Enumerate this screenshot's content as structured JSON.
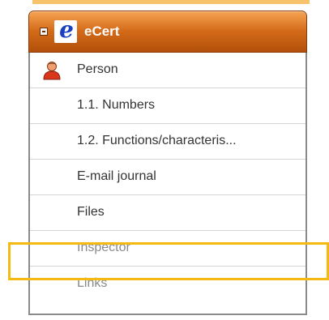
{
  "header": {
    "title": "eCert",
    "logo_letter": "e"
  },
  "menu": {
    "items": [
      {
        "label": "Person",
        "icon": "person-icon"
      },
      {
        "label": "1.1. Numbers"
      },
      {
        "label": "1.2. Functions/characteris..."
      },
      {
        "label": "E-mail journal"
      },
      {
        "label": "Files"
      },
      {
        "label": "Inspector"
      },
      {
        "label": "Links"
      }
    ]
  },
  "colors": {
    "header_top": "#f6a454",
    "header_bottom": "#b24f0a",
    "highlight": "#f5ba12"
  }
}
